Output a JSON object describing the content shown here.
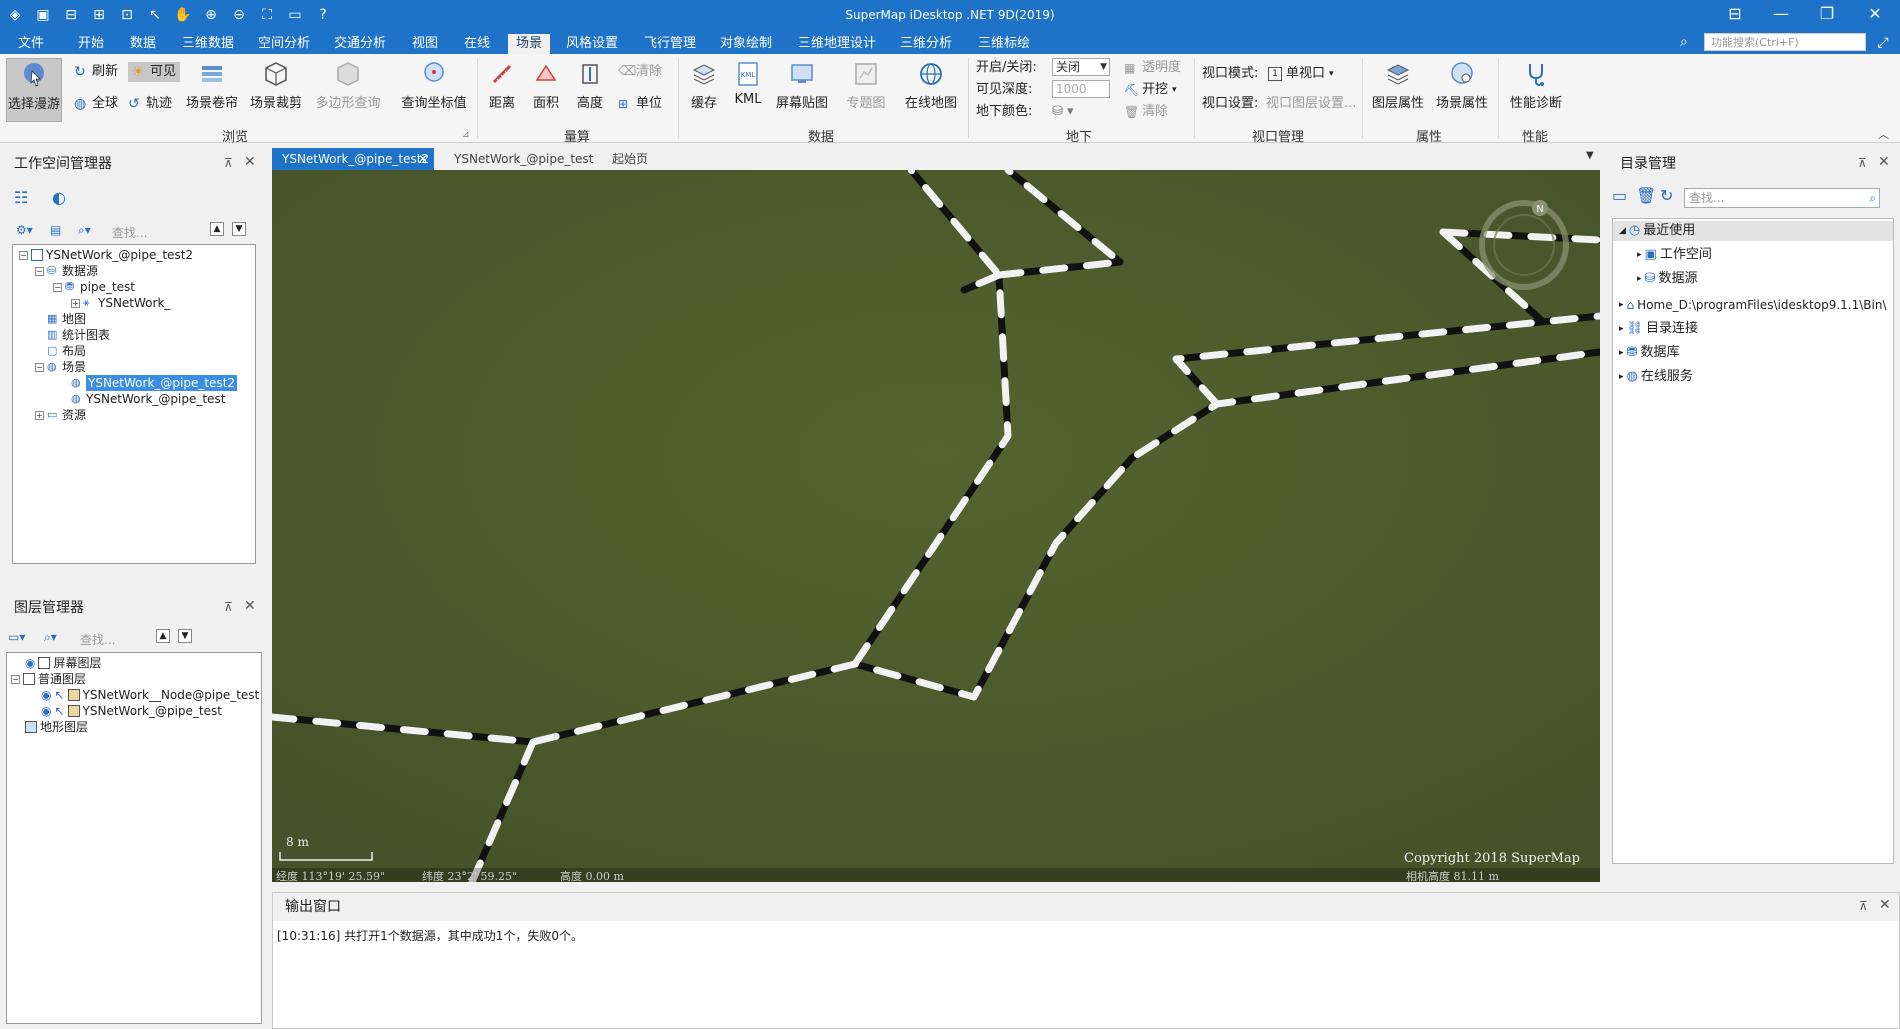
{
  "app": {
    "title": "SuperMap iDesktop .NET 9D(2019)"
  },
  "menu": {
    "tabs": [
      "文件",
      "开始",
      "数据",
      "三维数据",
      "空间分析",
      "交通分析",
      "视图",
      "在线",
      "场景",
      "风格设置",
      "飞行管理",
      "对象绘制",
      "三维地理设计",
      "三维分析",
      "三维标绘"
    ],
    "active": "场景",
    "search_placeholder": "功能搜索(Ctrl+F)"
  },
  "ribbon": {
    "browse": {
      "label": "浏览",
      "select_roam": "选择漫游",
      "refresh": "刷新",
      "visible": "可见",
      "globe": "全球",
      "track": "轨迹",
      "scene_roll": "场景卷帘",
      "scene_clip": "场景裁剪",
      "polygon_query": "多边形查询",
      "query_coord": "查询坐标值"
    },
    "measure": {
      "label": "量算",
      "distance": "距离",
      "area": "面积",
      "height": "高度",
      "clear": "清除",
      "unit": "单位"
    },
    "data": {
      "label": "数据",
      "cache": "缓存",
      "kml": "KML",
      "screen_map": "屏幕贴图",
      "thematic": "专题图",
      "online_map": "在线地图"
    },
    "underground": {
      "label": "地下",
      "onoff_label": "开启/关闭:",
      "onoff_value": "关闭",
      "depth_label": "可见深度:",
      "depth_value": "1000",
      "color_label": "地下颜色:",
      "transparency": "透明度",
      "excavate": "开挖",
      "clear": "清除"
    },
    "viewport": {
      "label": "视口管理",
      "mode_label": "视口模式:",
      "mode_value": "单视口",
      "settings_label": "视口设置:",
      "layer_settings": "视口图层设置..."
    },
    "properties": {
      "label": "属性",
      "layer_props": "图层属性",
      "scene_props": "场景属性"
    },
    "performance": {
      "label": "性能",
      "diagnose": "性能诊断"
    }
  },
  "workspace_panel": {
    "title": "工作空间管理器",
    "search_placeholder": "查找...",
    "tree": {
      "workspace": "YSNetWork_@pipe_test2",
      "datasources": "数据源",
      "pipe_test": "pipe_test",
      "ysnetwork": "YSNetWork_",
      "maps": "地图",
      "charts": "统计图表",
      "layouts": "布局",
      "scenes": "场景",
      "scene1": "YSNetWork_@pipe_test2",
      "scene2": "YSNetWork_@pipe_test",
      "resources": "资源"
    }
  },
  "layer_panel": {
    "title": "图层管理器",
    "search_placeholder": "查找...",
    "tree": {
      "screen_layers": "屏幕图层",
      "normal_layers": "普通图层",
      "layer1": "YSNetWork__Node@pipe_test",
      "layer2": "YSNetWork_@pipe_test",
      "terrain_layers": "地形图层"
    }
  },
  "doc_tabs": {
    "tab1": "YSNetWork_@pipe_test2",
    "tab2": "YSNetWork_@pipe_test",
    "tab3": "起始页"
  },
  "scene": {
    "scale_label": "8 m",
    "copyright": "Copyright 2018 SuperMap",
    "longitude": "经度 113°19' 25.59\"",
    "latitude": "纬度 23°2' 59.25\"",
    "altitude": "高度 0.00 m",
    "camera_height": "相机高度 81.11 m",
    "compass_letter": "N"
  },
  "catalog_panel": {
    "title": "目录管理",
    "search_placeholder": "查找...",
    "tree": {
      "recent": "最近使用",
      "workspace": "工作空间",
      "datasource": "数据源",
      "home": "Home_D:\\programFiles\\idesktop9.1.1\\Bin\\",
      "dir_conn": "目录连接",
      "database": "数据库",
      "online_service": "在线服务"
    }
  },
  "output": {
    "title": "输出窗口",
    "message": "[10:31:16] 共打开1个数据源，其中成功1个，失败0个。"
  }
}
